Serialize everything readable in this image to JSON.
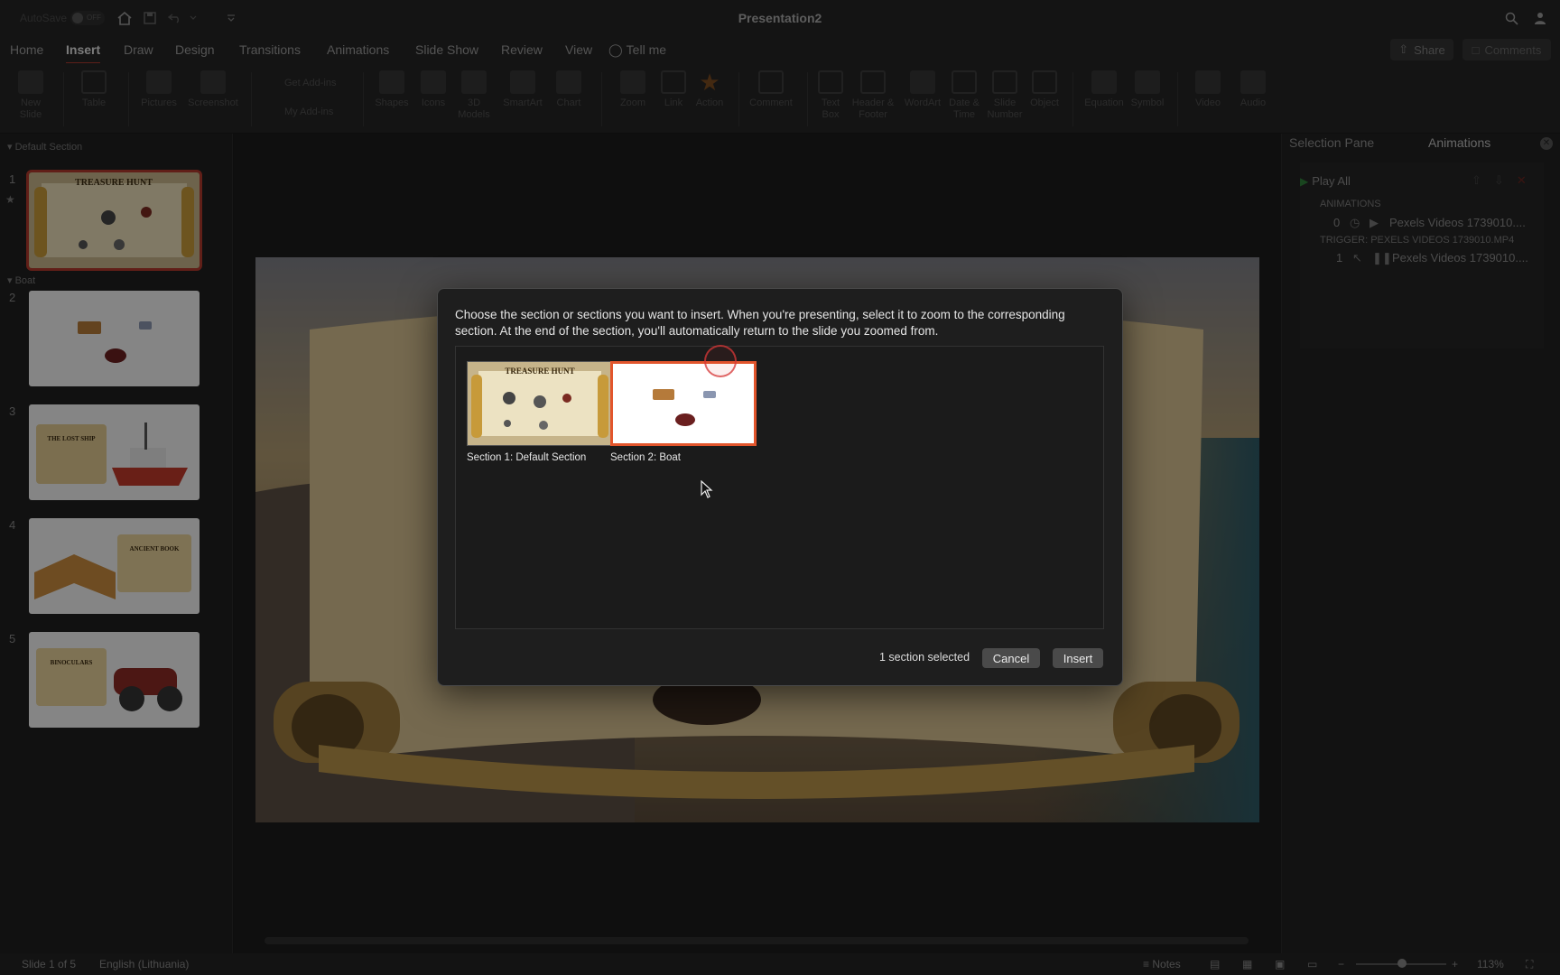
{
  "titlebar": {
    "autosave_label": "AutoSave",
    "autosave_state": "OFF",
    "title": "Presentation2"
  },
  "tabs": [
    {
      "label": "Home",
      "active": false
    },
    {
      "label": "Insert",
      "active": true
    },
    {
      "label": "Draw",
      "active": false
    },
    {
      "label": "Design",
      "active": false
    },
    {
      "label": "Transitions",
      "active": false
    },
    {
      "label": "Animations",
      "active": false
    },
    {
      "label": "Slide Show",
      "active": false
    },
    {
      "label": "Review",
      "active": false
    },
    {
      "label": "View",
      "active": false
    }
  ],
  "tellme": "Tell me",
  "share_label": "Share",
  "comments_label": "Comments",
  "ribbon": {
    "new_slide": "New\nSlide",
    "table": "Table",
    "pictures": "Pictures",
    "screenshot": "Screenshot",
    "get_addins": "Get Add-ins",
    "my_addins": "My Add-ins",
    "shapes": "Shapes",
    "icons": "Icons",
    "models3d": "3D\nModels",
    "smartart": "SmartArt",
    "chart": "Chart",
    "zoom": "Zoom",
    "link": "Link",
    "action": "Action",
    "comment": "Comment",
    "textbox": "Text\nBox",
    "header_footer": "Header &\nFooter",
    "wordart": "WordArt",
    "date_time": "Date &\nTime",
    "slide_number": "Slide\nNumber",
    "object": "Object",
    "equation": "Equation",
    "symbol": "Symbol",
    "video": "Video",
    "audio": "Audio"
  },
  "sections": [
    {
      "name": "Default Section"
    },
    {
      "name": "Boat"
    }
  ],
  "slides": [
    {
      "number": "1",
      "title": "TREASURE HUNT"
    },
    {
      "number": "2"
    },
    {
      "number": "3",
      "title": "THE LOST SHIP"
    },
    {
      "number": "4",
      "title": "ANCIENT BOOK"
    },
    {
      "number": "5",
      "title": "BINOCULARS"
    }
  ],
  "pane": {
    "tab_selection": "Selection Pane",
    "tab_animations": "Animations",
    "play_all": "Play All",
    "animations_header": "ANIMATIONS",
    "row1_num": "0",
    "row1_name": "Pexels Videos 1739010....",
    "trigger": "TRIGGER: PEXELS VIDEOS 1739010.MP4",
    "row2_num": "1",
    "row2_name": "Pexels Videos 1739010...."
  },
  "dialog": {
    "message": "Choose the section or sections you want to insert. When you're presenting, select it to zoom to the corresponding section. At the end of the section, you'll automatically return to the slide you zoomed from.",
    "items": [
      {
        "caption": "Section 1: Default Section",
        "selected": false
      },
      {
        "caption": "Section 2: Boat",
        "selected": true
      }
    ],
    "selected_count": "1 section selected",
    "cancel": "Cancel",
    "insert": "Insert"
  },
  "status": {
    "slide_info": "Slide 1 of 5",
    "language": "English (Lithuania)",
    "notes": "Notes",
    "zoom": "113%"
  },
  "colors": {
    "accent_red": "#b1392c",
    "selection_orange": "#e2552c",
    "play_green": "#2f7f3a"
  }
}
